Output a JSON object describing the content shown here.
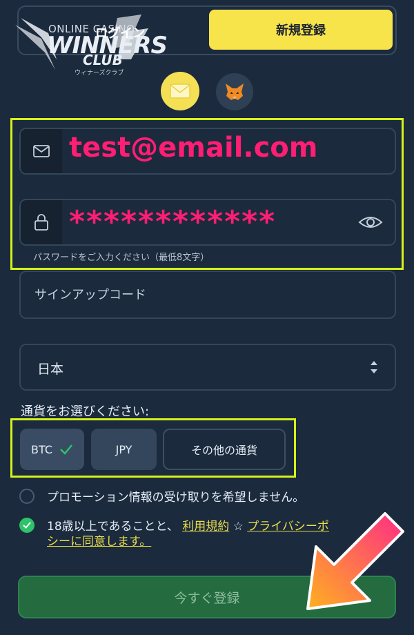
{
  "tabs": {
    "login": "ログイン",
    "register": "新規登録"
  },
  "logo": {
    "online": "ONLINE CASINO",
    "main": "WINNERS",
    "club": "CLUB",
    "kana": "ウィナーズクラブ"
  },
  "form": {
    "email_value": "test@email.com",
    "password_value": "************",
    "password_hint": "パスワードをご入力ください（最低8文字）",
    "signup_code_placeholder": "サインアップコード",
    "country_value": "日本",
    "currency_label": "通貨をお選びください:",
    "currencies": [
      "BTC",
      "JPY",
      "その他の通貨"
    ],
    "selected_currency": "BTC",
    "promo_optout": "プロモーション情報の受け取りを希望しません。",
    "agree_prefix": "18歳以上であることと、",
    "terms_link": "利用規約",
    "star": "☆",
    "privacy_link_part1": "プライバシーポ",
    "privacy_link_part2": "シーに同意します。",
    "submit": "今すぐ登録"
  },
  "colors": {
    "background": "#1b2a3d",
    "accent_yellow": "#f7e34a",
    "highlight": "#d6f21a",
    "input_text": "#ff1e73",
    "check_green": "#2ec26a",
    "submit_green": "#246b3f"
  }
}
